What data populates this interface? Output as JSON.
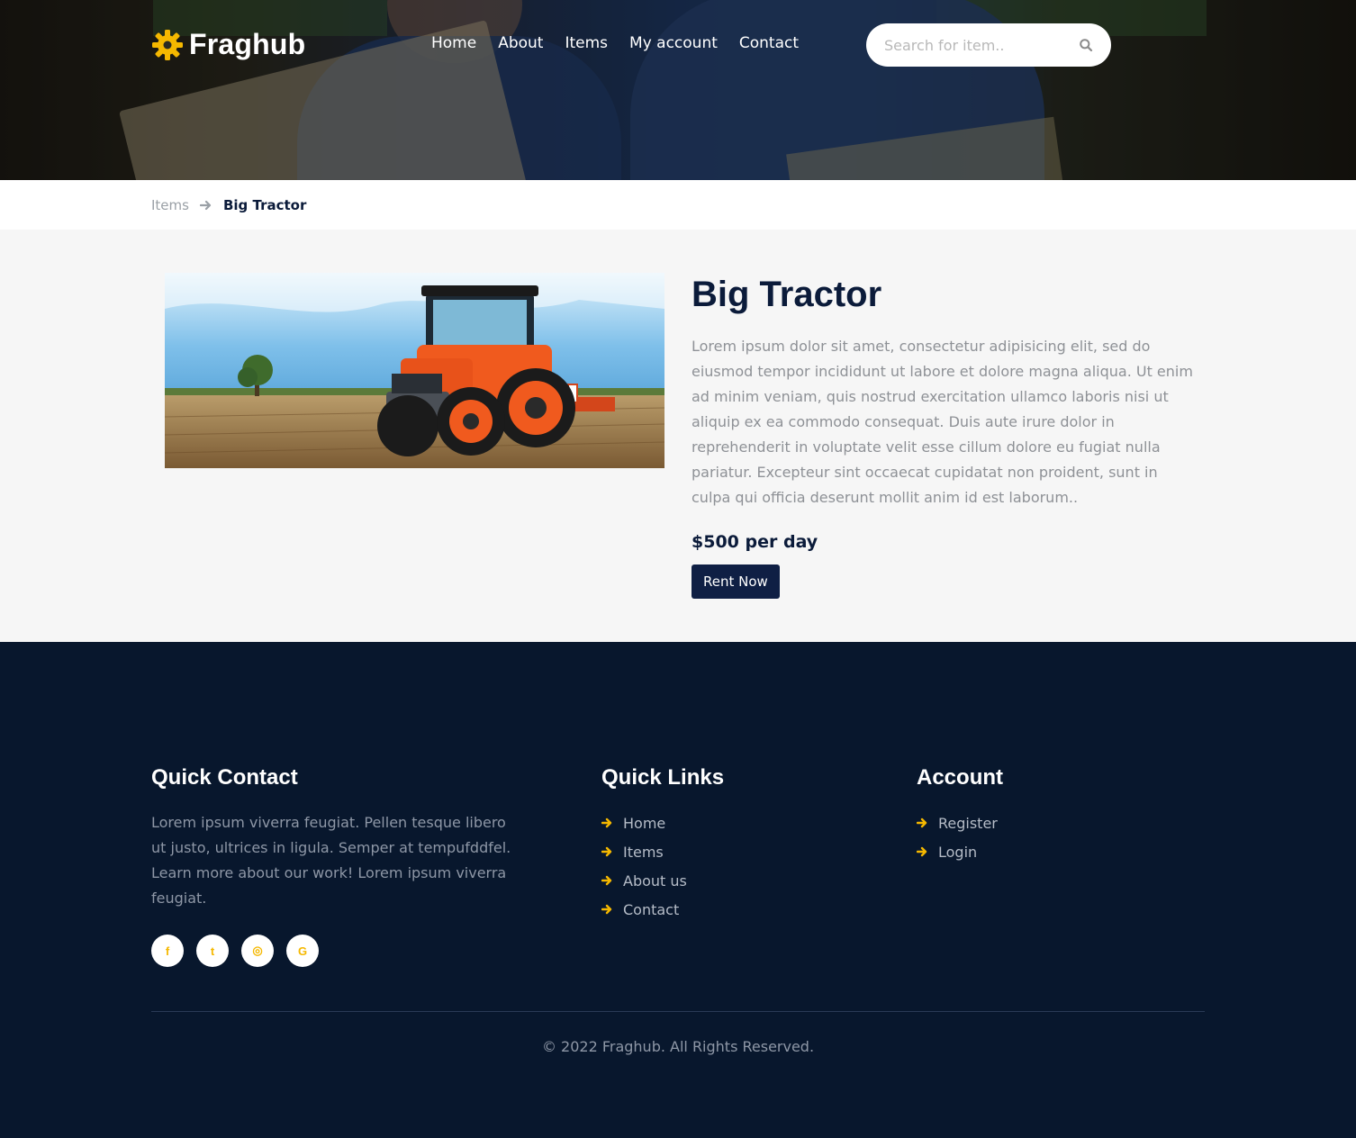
{
  "header": {
    "brand": "Fraghub",
    "nav": [
      {
        "label": "Home"
      },
      {
        "label": "About"
      },
      {
        "label": "Items"
      },
      {
        "label": "My account"
      },
      {
        "label": "Contact"
      }
    ],
    "search": {
      "placeholder": "Search for item.."
    }
  },
  "breadcrumb": {
    "parent": "Items",
    "current": "Big Tractor"
  },
  "product": {
    "title": "Big Tractor",
    "description": "Lorem ipsum dolor sit amet, consectetur adipisicing elit, sed do eiusmod tempor incididunt ut labore et dolore magna aliqua. Ut enim ad minim veniam, quis nostrud exercitation ullamco laboris nisi ut aliquip ex ea commodo consequat. Duis aute irure dolor in reprehenderit in voluptate velit esse cillum dolore eu fugiat nulla pariatur. Excepteur sint occaecat cupidatat non proident, sunt in culpa qui officia deserunt mollit anim id est laborum..",
    "price": "$500 per day",
    "cta": "Rent Now"
  },
  "footer": {
    "contact": {
      "heading": "Quick Contact",
      "text": "Lorem ipsum viverra feugiat. Pellen tesque libero ut justo, ultrices in ligula. Semper at tempufddfel. Learn more about our work! Lorem ipsum viverra feugiat.",
      "socials": [
        {
          "icon": "facebook-icon",
          "glyph": "f"
        },
        {
          "icon": "twitter-icon",
          "glyph": "t"
        },
        {
          "icon": "dribbble-icon",
          "glyph": "◎"
        },
        {
          "icon": "google-icon",
          "glyph": "G"
        }
      ]
    },
    "quick_links": {
      "heading": "Quick Links",
      "items": [
        {
          "label": "Home"
        },
        {
          "label": "Items"
        },
        {
          "label": "About us"
        },
        {
          "label": "Contact"
        }
      ]
    },
    "account": {
      "heading": "Account",
      "items": [
        {
          "label": "Register"
        },
        {
          "label": "Login"
        }
      ]
    },
    "copyright": "© 2022 Fraghub. All Rights Reserved."
  },
  "colors": {
    "accent": "#f5b800",
    "navy": "#0f1f44",
    "footer_bg": "#08172d"
  }
}
